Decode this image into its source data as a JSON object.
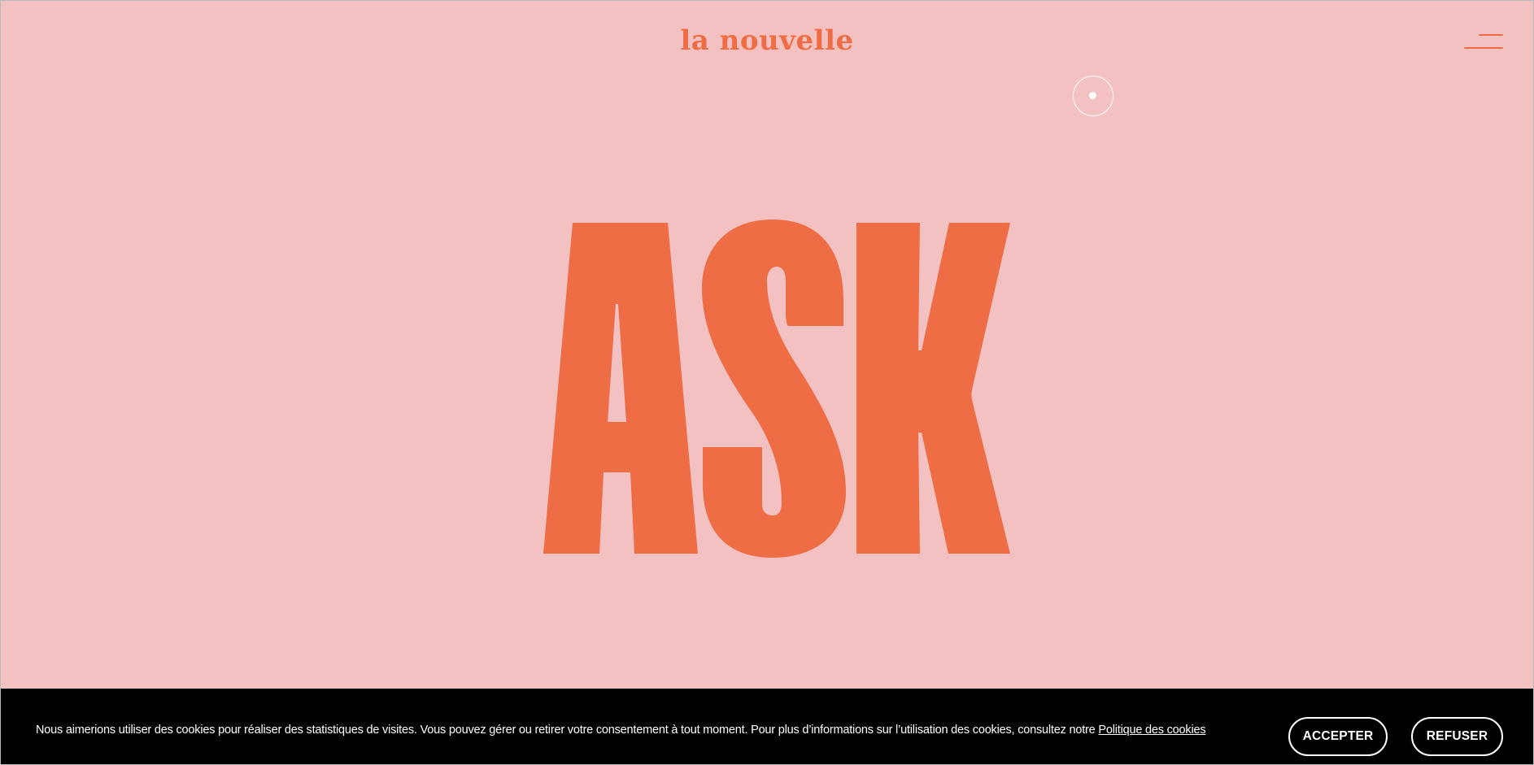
{
  "header": {
    "logo": "la nouvelle",
    "menu_icon": "hamburger-menu-icon"
  },
  "hero": {
    "word": "ASK"
  },
  "cookie_banner": {
    "message": "Nous aimerions utiliser des cookies pour réaliser des statistiques de visites. Vous pouvez gérer ou retirer votre consentement à tout moment. Pour plus d’informations sur l’utilisation des cookies, consultez notre ",
    "policy_link": "Politique des cookies",
    "accept_label": "ACCEPTER",
    "refuse_label": "REFUSER"
  },
  "colors": {
    "background": "#f3c1c1",
    "accent": "#ee6d45",
    "banner": "#000000",
    "banner_text": "#ffffff"
  }
}
